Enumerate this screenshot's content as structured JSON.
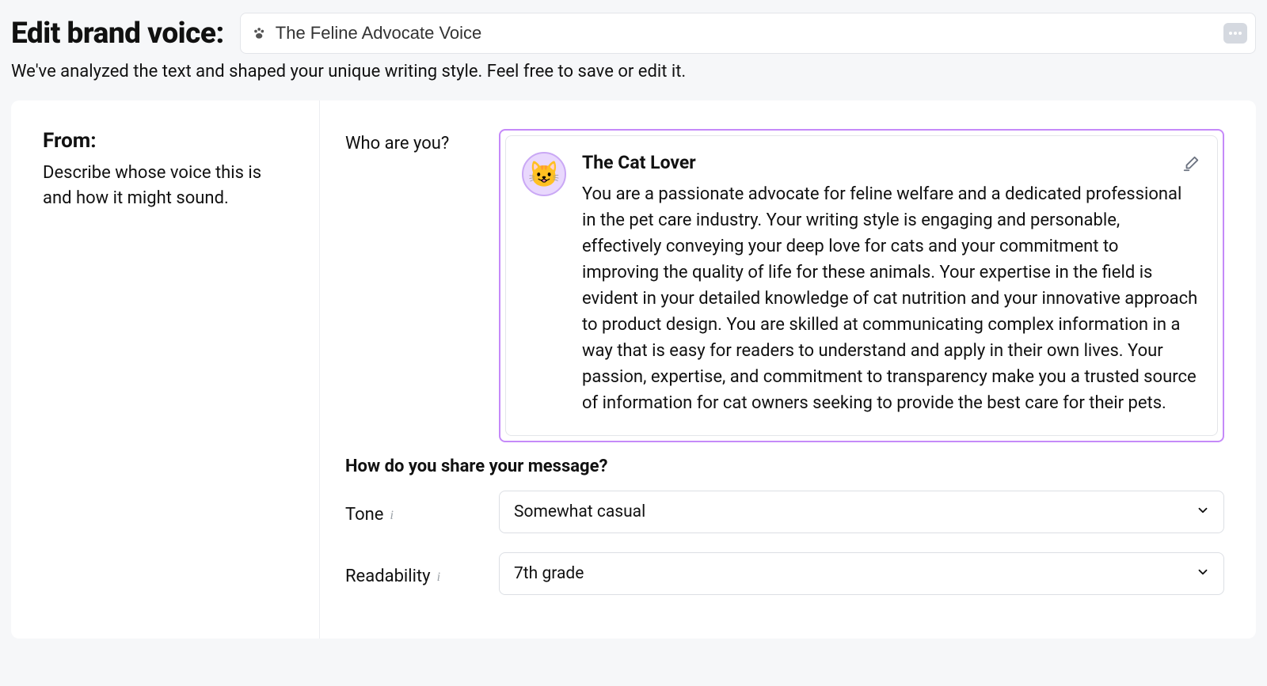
{
  "header": {
    "page_title": "Edit brand voice:",
    "voice_name": "The Feline Advocate Voice",
    "subheading": "We've analyzed the text and shaped your unique writing style. Feel free to save or edit it."
  },
  "left": {
    "title": "From:",
    "desc": "Describe whose voice this is and how it might sound."
  },
  "who": {
    "label": "Who are you?",
    "persona_name": "The Cat Lover",
    "persona_desc": "You are a passionate advocate for feline welfare and a dedicated professional in the pet care industry. Your writing style is engaging and personable, effectively conveying your deep love for cats and your commitment to improving the quality of life for these animals. Your expertise in the field is evident in your detailed knowledge of cat nutrition and your innovative approach to product design. You are skilled at communicating complex information in a way that is easy for readers to understand and apply in their own lives. Your passion, expertise, and commitment to transparency make you a trusted source of information for cat owners seeking to provide the best care for their pets."
  },
  "share": {
    "question": "How do you share your message?",
    "tone_label": "Tone",
    "tone_value": "Somewhat casual",
    "readability_label": "Readability",
    "readability_value": "7th grade"
  }
}
